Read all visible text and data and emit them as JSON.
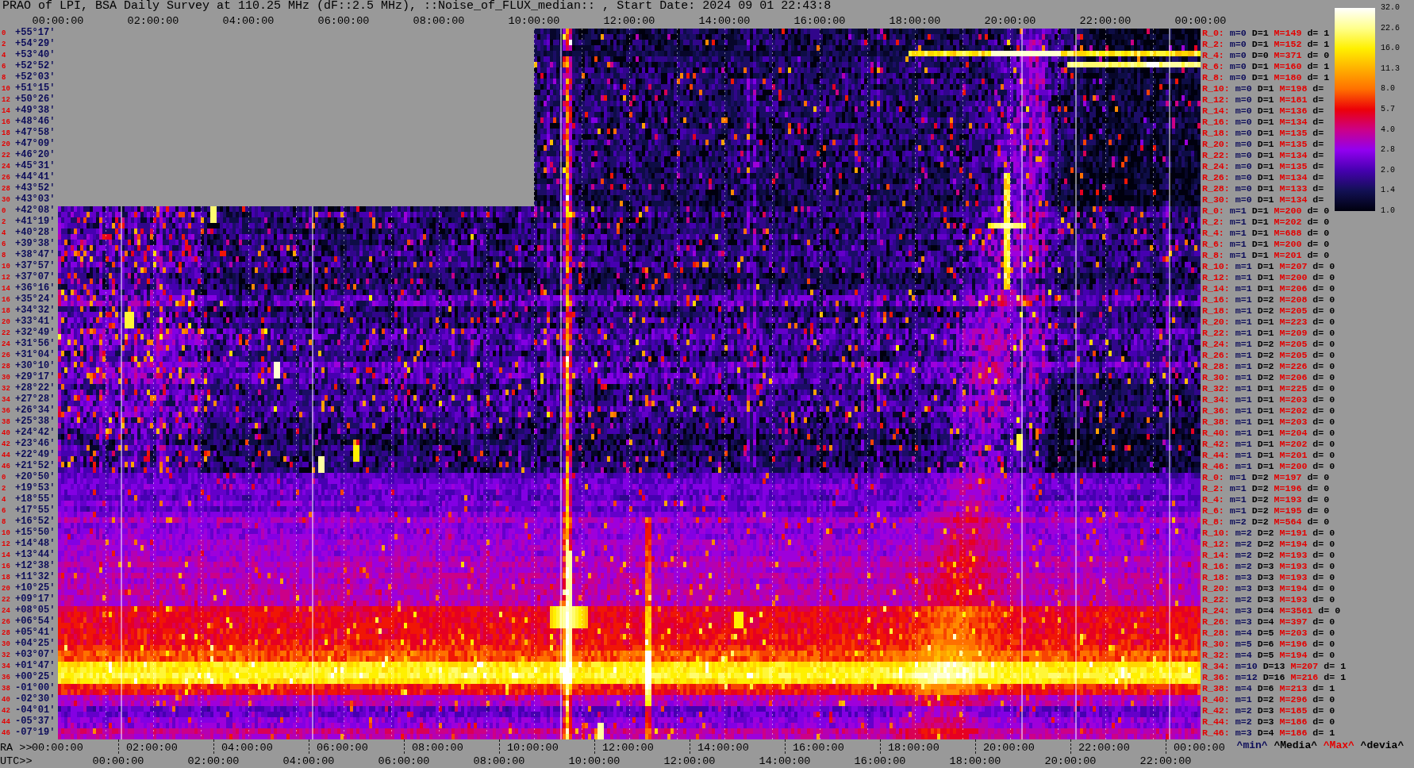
{
  "title": "PRAO of LPI, BSA Daily Survey at 110.25 MHz (dF::2.5 MHz), ::Noise_of_FLUX_median:: , Start Date: 2024 09 01 22:43:8",
  "top_axis": {
    "labels": [
      "00:00:00",
      "02:00:00",
      "04:00:00",
      "06:00:00",
      "08:00:00",
      "10:00:00",
      "12:00:00",
      "14:00:00",
      "16:00:00",
      "18:00:00",
      "20:00:00",
      "22:00:00",
      "00:00:00"
    ]
  },
  "declination_axis": {
    "rows": [
      {
        "beam": "0",
        "declination": "+55°17'"
      },
      {
        "beam": "2",
        "declination": "+54°29'"
      },
      {
        "beam": "4",
        "declination": "+53°40'"
      },
      {
        "beam": "6",
        "declination": "+52°52'"
      },
      {
        "beam": "8",
        "declination": "+52°03'"
      },
      {
        "beam": "10",
        "declination": "+51°15'"
      },
      {
        "beam": "12",
        "declination": "+50°26'"
      },
      {
        "beam": "14",
        "declination": "+49°38'"
      },
      {
        "beam": "16",
        "declination": "+48°46'"
      },
      {
        "beam": "18",
        "declination": "+47°58'"
      },
      {
        "beam": "20",
        "declination": "+47°09'"
      },
      {
        "beam": "22",
        "declination": "+46°20'"
      },
      {
        "beam": "24",
        "declination": "+45°31'"
      },
      {
        "beam": "26",
        "declination": "+44°41'"
      },
      {
        "beam": "28",
        "declination": "+43°52'"
      },
      {
        "beam": "30",
        "declination": "+43°03'"
      },
      {
        "beam": "0",
        "declination": "+42°08'"
      },
      {
        "beam": "2",
        "declination": "+41°19'"
      },
      {
        "beam": "4",
        "declination": "+40°28'"
      },
      {
        "beam": "6",
        "declination": "+39°38'"
      },
      {
        "beam": "8",
        "declination": "+38°47'"
      },
      {
        "beam": "10",
        "declination": "+37°57'"
      },
      {
        "beam": "12",
        "declination": "+37°07'"
      },
      {
        "beam": "14",
        "declination": "+36°16'"
      },
      {
        "beam": "16",
        "declination": "+35°24'"
      },
      {
        "beam": "18",
        "declination": "+34°32'"
      },
      {
        "beam": "20",
        "declination": "+33°41'"
      },
      {
        "beam": "22",
        "declination": "+32°49'"
      },
      {
        "beam": "24",
        "declination": "+31°56'"
      },
      {
        "beam": "26",
        "declination": "+31°04'"
      },
      {
        "beam": "28",
        "declination": "+30°10'"
      },
      {
        "beam": "30",
        "declination": "+29°17'"
      },
      {
        "beam": "32",
        "declination": "+28°22'"
      },
      {
        "beam": "34",
        "declination": "+27°28'"
      },
      {
        "beam": "36",
        "declination": "+26°34'"
      },
      {
        "beam": "38",
        "declination": "+25°38'"
      },
      {
        "beam": "40",
        "declination": "+24°42'"
      },
      {
        "beam": "42",
        "declination": "+23°46'"
      },
      {
        "beam": "44",
        "declination": "+22°49'"
      },
      {
        "beam": "46",
        "declination": "+21°52'"
      },
      {
        "beam": "0",
        "declination": "+20°50'"
      },
      {
        "beam": "2",
        "declination": "+19°53'"
      },
      {
        "beam": "4",
        "declination": "+18°55'"
      },
      {
        "beam": "6",
        "declination": "+17°55'"
      },
      {
        "beam": "8",
        "declination": "+16°52'"
      },
      {
        "beam": "10",
        "declination": "+15°50'"
      },
      {
        "beam": "12",
        "declination": "+14°48'"
      },
      {
        "beam": "14",
        "declination": "+13°44'"
      },
      {
        "beam": "16",
        "declination": "+12°38'"
      },
      {
        "beam": "18",
        "declination": "+11°32'"
      },
      {
        "beam": "20",
        "declination": "+10°25'"
      },
      {
        "beam": "22",
        "declination": "+09°17'"
      },
      {
        "beam": "24",
        "declination": "+08°05'"
      },
      {
        "beam": "26",
        "declination": "+06°54'"
      },
      {
        "beam": "28",
        "declination": "+05°41'"
      },
      {
        "beam": "30",
        "declination": "+04°25'"
      },
      {
        "beam": "32",
        "declination": "+03°07'"
      },
      {
        "beam": "34",
        "declination": "+01°47'"
      },
      {
        "beam": "36",
        "declination": "+00°25'"
      },
      {
        "beam": "38",
        "declination": "-01°00'"
      },
      {
        "beam": "40",
        "declination": "-02°30'"
      },
      {
        "beam": "42",
        "declination": "-04°01'"
      },
      {
        "beam": "44",
        "declination": "-05°37'"
      },
      {
        "beam": "46",
        "declination": "-07°19'"
      }
    ]
  },
  "beam_stats": {
    "rows": [
      {
        "beam": "R_0:",
        "min": "m=0",
        "median": "D=1",
        "max": "M=149",
        "deviation": "d= 1"
      },
      {
        "beam": "R_2:",
        "min": "m=0",
        "median": "D=1",
        "max": "M=152",
        "deviation": "d= 1"
      },
      {
        "beam": "R_4:",
        "min": "m=0",
        "median": "D=0",
        "max": "M=371",
        "deviation": "d= 0"
      },
      {
        "beam": "R_6:",
        "min": "m=0",
        "median": "D=1",
        "max": "M=160",
        "deviation": "d= 1"
      },
      {
        "beam": "R_8:",
        "min": "m=0",
        "median": "D=1",
        "max": "M=180",
        "deviation": "d= 1"
      },
      {
        "beam": "R_10:",
        "min": "m=0",
        "median": "D=1",
        "max": "M=198",
        "deviation": "d="
      },
      {
        "beam": "R_12:",
        "min": "m=0",
        "median": "D=1",
        "max": "M=181",
        "deviation": "d="
      },
      {
        "beam": "R_14:",
        "min": "m=0",
        "median": "D=1",
        "max": "M=136",
        "deviation": "d="
      },
      {
        "beam": "R_16:",
        "min": "m=0",
        "median": "D=1",
        "max": "M=134",
        "deviation": "d="
      },
      {
        "beam": "R_18:",
        "min": "m=0",
        "median": "D=1",
        "max": "M=135",
        "deviation": "d="
      },
      {
        "beam": "R_20:",
        "min": "m=0",
        "median": "D=1",
        "max": "M=135",
        "deviation": "d="
      },
      {
        "beam": "R_22:",
        "min": "m=0",
        "median": "D=1",
        "max": "M=134",
        "deviation": "d="
      },
      {
        "beam": "R_24:",
        "min": "m=0",
        "median": "D=1",
        "max": "M=135",
        "deviation": "d="
      },
      {
        "beam": "R_26:",
        "min": "m=0",
        "median": "D=1",
        "max": "M=134",
        "deviation": "d="
      },
      {
        "beam": "R_28:",
        "min": "m=0",
        "median": "D=1",
        "max": "M=133",
        "deviation": "d="
      },
      {
        "beam": "R_30:",
        "min": "m=0",
        "median": "D=1",
        "max": "M=134",
        "deviation": "d="
      },
      {
        "beam": "R_0:",
        "min": "m=1",
        "median": "D=1",
        "max": "M=200",
        "deviation": "d= 0"
      },
      {
        "beam": "R_2:",
        "min": "m=1",
        "median": "D=1",
        "max": "M=202",
        "deviation": "d= 0"
      },
      {
        "beam": "R_4:",
        "min": "m=1",
        "median": "D=1",
        "max": "M=688",
        "deviation": "d= 0"
      },
      {
        "beam": "R_6:",
        "min": "m=1",
        "median": "D=1",
        "max": "M=200",
        "deviation": "d= 0"
      },
      {
        "beam": "R_8:",
        "min": "m=1",
        "median": "D=1",
        "max": "M=201",
        "deviation": "d= 0"
      },
      {
        "beam": "R_10:",
        "min": "m=1",
        "median": "D=1",
        "max": "M=207",
        "deviation": "d= 0"
      },
      {
        "beam": "R_12:",
        "min": "m=1",
        "median": "D=1",
        "max": "M=200",
        "deviation": "d= 0"
      },
      {
        "beam": "R_14:",
        "min": "m=1",
        "median": "D=1",
        "max": "M=206",
        "deviation": "d= 0"
      },
      {
        "beam": "R_16:",
        "min": "m=1",
        "median": "D=2",
        "max": "M=208",
        "deviation": "d= 0"
      },
      {
        "beam": "R_18:",
        "min": "m=1",
        "median": "D=2",
        "max": "M=205",
        "deviation": "d= 0"
      },
      {
        "beam": "R_20:",
        "min": "m=1",
        "median": "D=1",
        "max": "M=223",
        "deviation": "d= 0"
      },
      {
        "beam": "R_22:",
        "min": "m=1",
        "median": "D=1",
        "max": "M=209",
        "deviation": "d= 0"
      },
      {
        "beam": "R_24:",
        "min": "m=1",
        "median": "D=2",
        "max": "M=205",
        "deviation": "d= 0"
      },
      {
        "beam": "R_26:",
        "min": "m=1",
        "median": "D=2",
        "max": "M=205",
        "deviation": "d= 0"
      },
      {
        "beam": "R_28:",
        "min": "m=1",
        "median": "D=2",
        "max": "M=226",
        "deviation": "d= 0"
      },
      {
        "beam": "R_30:",
        "min": "m=1",
        "median": "D=2",
        "max": "M=206",
        "deviation": "d= 0"
      },
      {
        "beam": "R_32:",
        "min": "m=1",
        "median": "D=1",
        "max": "M=225",
        "deviation": "d= 0"
      },
      {
        "beam": "R_34:",
        "min": "m=1",
        "median": "D=1",
        "max": "M=203",
        "deviation": "d= 0"
      },
      {
        "beam": "R_36:",
        "min": "m=1",
        "median": "D=1",
        "max": "M=202",
        "deviation": "d= 0"
      },
      {
        "beam": "R_38:",
        "min": "m=1",
        "median": "D=1",
        "max": "M=203",
        "deviation": "d= 0"
      },
      {
        "beam": "R_40:",
        "min": "m=1",
        "median": "D=1",
        "max": "M=204",
        "deviation": "d= 0"
      },
      {
        "beam": "R_42:",
        "min": "m=1",
        "median": "D=1",
        "max": "M=202",
        "deviation": "d= 0"
      },
      {
        "beam": "R_44:",
        "min": "m=1",
        "median": "D=1",
        "max": "M=201",
        "deviation": "d= 0"
      },
      {
        "beam": "R_46:",
        "min": "m=1",
        "median": "D=1",
        "max": "M=200",
        "deviation": "d= 0"
      },
      {
        "beam": "R_0:",
        "min": "m=1",
        "median": "D=2",
        "max": "M=197",
        "deviation": "d= 0"
      },
      {
        "beam": "R_2:",
        "min": "m=1",
        "median": "D=2",
        "max": "M=196",
        "deviation": "d= 0"
      },
      {
        "beam": "R_4:",
        "min": "m=1",
        "median": "D=2",
        "max": "M=193",
        "deviation": "d= 0"
      },
      {
        "beam": "R_6:",
        "min": "m=1",
        "median": "D=2",
        "max": "M=195",
        "deviation": "d= 0"
      },
      {
        "beam": "R_8:",
        "min": "m=2",
        "median": "D=2",
        "max": "M=564",
        "deviation": "d= 0"
      },
      {
        "beam": "R_10:",
        "min": "m=2",
        "median": "D=2",
        "max": "M=191",
        "deviation": "d= 0"
      },
      {
        "beam": "R_12:",
        "min": "m=2",
        "median": "D=2",
        "max": "M=194",
        "deviation": "d= 0"
      },
      {
        "beam": "R_14:",
        "min": "m=2",
        "median": "D=2",
        "max": "M=193",
        "deviation": "d= 0"
      },
      {
        "beam": "R_16:",
        "min": "m=2",
        "median": "D=3",
        "max": "M=193",
        "deviation": "d= 0"
      },
      {
        "beam": "R_18:",
        "min": "m=3",
        "median": "D=3",
        "max": "M=193",
        "deviation": "d= 0"
      },
      {
        "beam": "R_20:",
        "min": "m=3",
        "median": "D=3",
        "max": "M=194",
        "deviation": "d= 0"
      },
      {
        "beam": "R_22:",
        "min": "m=2",
        "median": "D=3",
        "max": "M=193",
        "deviation": "d= 0"
      },
      {
        "beam": "R_24:",
        "min": "m=3",
        "median": "D=4",
        "max": "M=3561",
        "deviation": "d= 0"
      },
      {
        "beam": "R_26:",
        "min": "m=3",
        "median": "D=4",
        "max": "M=397",
        "deviation": "d= 0"
      },
      {
        "beam": "R_28:",
        "min": "m=4",
        "median": "D=5",
        "max": "M=203",
        "deviation": "d= 0"
      },
      {
        "beam": "R_30:",
        "min": "m=5",
        "median": "D=6",
        "max": "M=196",
        "deviation": "d= 0"
      },
      {
        "beam": "R_32:",
        "min": "m=4",
        "median": "D=5",
        "max": "M=194",
        "deviation": "d= 0"
      },
      {
        "beam": "R_34:",
        "min": "m=10",
        "median": "D=13",
        "max": "M=207",
        "deviation": "d= 1"
      },
      {
        "beam": "R_36:",
        "min": "m=12",
        "median": "D=16",
        "max": "M=216",
        "deviation": "d= 1"
      },
      {
        "beam": "R_38:",
        "min": "m=4",
        "median": "D=6",
        "max": "M=213",
        "deviation": "d= 1"
      },
      {
        "beam": "R_40:",
        "min": "m=1",
        "median": "D=2",
        "max": "M=296",
        "deviation": "d= 0"
      },
      {
        "beam": "R_42:",
        "min": "m=2",
        "median": "D=3",
        "max": "M=185",
        "deviation": "d= 0"
      },
      {
        "beam": "R_44:",
        "min": "m=2",
        "median": "D=3",
        "max": "M=186",
        "deviation": "d= 0"
      },
      {
        "beam": "R_46:",
        "min": "m=3",
        "median": "D=4",
        "max": "M=186",
        "deviation": "d= 1"
      }
    ]
  },
  "colorbar": {
    "ticks": [
      "32.0",
      "22.6",
      "16.0",
      "11.3",
      "8.0",
      "5.7",
      "4.0",
      "2.8",
      "2.0",
      "1.4",
      "1.0"
    ]
  },
  "ra_axis": {
    "prefix": "RA >>",
    "labels": [
      "00:00:00",
      "02:00:00",
      "04:00:00",
      "06:00:00",
      "08:00:00",
      "10:00:00",
      "12:00:00",
      "14:00:00",
      "16:00:00",
      "18:00:00",
      "20:00:00",
      "22:00:00",
      "00:00:00"
    ]
  },
  "legend": [
    {
      "kind": "min",
      "label": "^min^"
    },
    {
      "kind": "median",
      "label": "^Media^"
    },
    {
      "kind": "max",
      "label": "^Max^"
    },
    {
      "kind": "deviation",
      "label": "^devia^"
    }
  ],
  "utc_axis": {
    "prefix": "UTC>>",
    "labels": [
      "00:00:00",
      "02:00:00",
      "04:00:00",
      "06:00:00",
      "08:00:00",
      "10:00:00",
      "12:00:00",
      "14:00:00",
      "16:00:00",
      "18:00:00",
      "20:00:00",
      "22:00:00"
    ]
  }
}
